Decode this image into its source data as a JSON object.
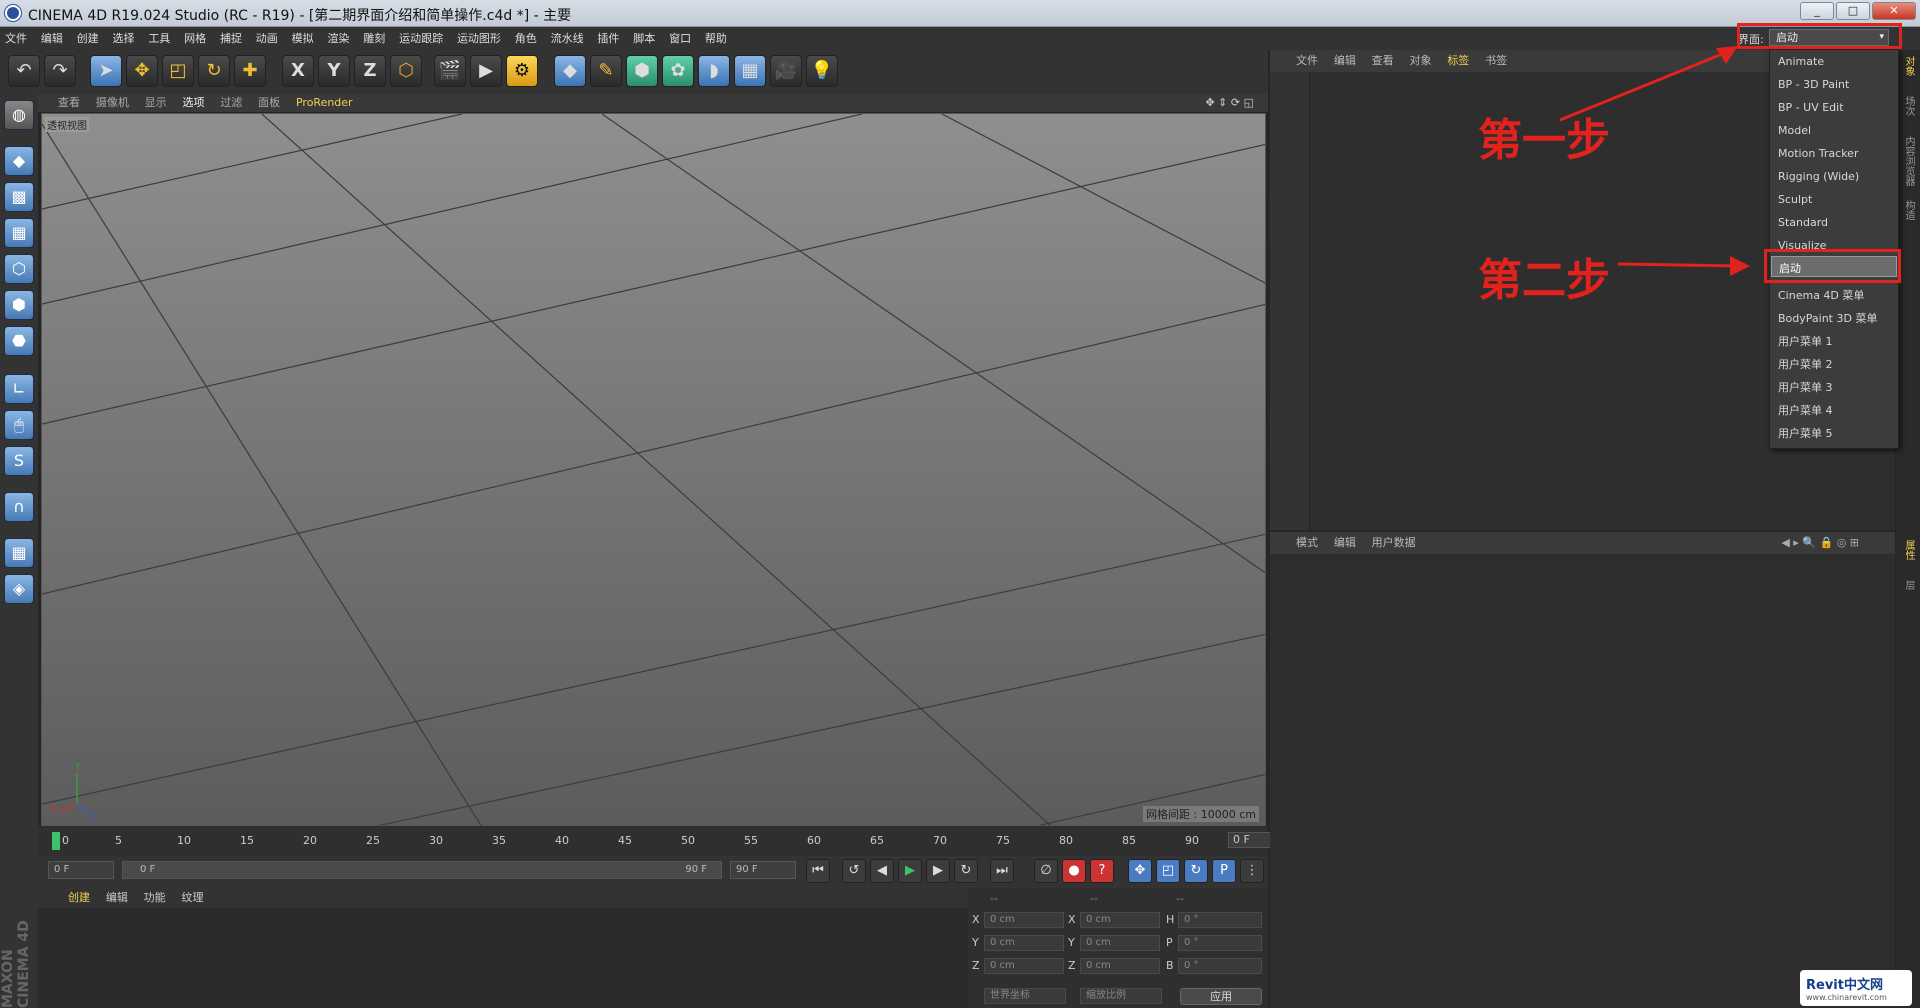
{
  "window": {
    "title": "CINEMA 4D R19.024 Studio (RC - R19) - [第二期界面介绍和简单操作.c4d *] - 主要",
    "controls": {
      "minimize": "_",
      "restore": "□",
      "close": "✕"
    }
  },
  "menu": [
    "文件",
    "编辑",
    "创建",
    "选择",
    "工具",
    "网格",
    "捕捉",
    "动画",
    "模拟",
    "渲染",
    "雕刻",
    "运动跟踪",
    "运动图形",
    "角色",
    "流水线",
    "插件",
    "脚本",
    "窗口",
    "帮助"
  ],
  "layout_selector": {
    "label": "界面:",
    "value": "启动",
    "arrow": "▾"
  },
  "toolbar_icons": [
    "undo-icon",
    "redo-icon",
    "select-icon",
    "move-icon",
    "scale-icon",
    "rotate-icon",
    "add-icon",
    "x-axis-icon",
    "y-axis-icon",
    "z-axis-icon",
    "coordinate-system-icon",
    "render-view-icon",
    "render-picture-queue-icon",
    "render-settings-icon",
    "cube-icon",
    "pen-icon",
    "subdivision-icon",
    "cloner-icon",
    "deformer-icon",
    "floor-icon",
    "camera-icon",
    "light-icon"
  ],
  "toolbar_glyphs": {
    "x": "X",
    "y": "Y",
    "z": "Z"
  },
  "viewport": {
    "menu": [
      "查看",
      "摄像机",
      "显示",
      "选项",
      "过滤",
      "面板",
      "ProRender"
    ],
    "label": "透视视图",
    "grid_info": "网格间距 : 10000 cm",
    "axis": {
      "x": "X",
      "y": "Y",
      "z": "Z"
    }
  },
  "timeline": {
    "ticks": [
      "0",
      "5",
      "10",
      "15",
      "20",
      "25",
      "30",
      "35",
      "40",
      "45",
      "50",
      "55",
      "60",
      "65",
      "70",
      "75",
      "80",
      "85",
      "90"
    ],
    "current_frame": "0 F"
  },
  "transport": {
    "start_field": "0 F",
    "range_start": "0 F",
    "range_end": "90 F",
    "end_field": "90 F"
  },
  "material_panel": {
    "tabs": [
      "创建",
      "编辑",
      "功能",
      "纹理"
    ]
  },
  "coord_panel": {
    "headers": [
      "--",
      "--",
      "--"
    ],
    "rows": [
      {
        "a": "X",
        "av": "0 cm",
        "b": "X",
        "bv": "0 cm",
        "c": "H",
        "cv": "0 °"
      },
      {
        "a": "Y",
        "av": "0 cm",
        "b": "Y",
        "bv": "0 cm",
        "c": "P",
        "cv": "0 °"
      },
      {
        "a": "Z",
        "av": "0 cm",
        "b": "Z",
        "bv": "0 cm",
        "c": "B",
        "cv": "0 °"
      }
    ],
    "mode_world": "世界坐标",
    "mode_scale": "缩放比例",
    "apply": "应用"
  },
  "object_manager": {
    "tabs": [
      "文件",
      "编辑",
      "查看",
      "对象",
      "标签",
      "书签"
    ],
    "active_tab": "标签"
  },
  "attribute_manager": {
    "tabs": [
      "模式",
      "编辑",
      "用户数据"
    ]
  },
  "right_strip": [
    "对象",
    "场次",
    "内容浏览器",
    "构造",
    "属性",
    "层"
  ],
  "layout_dropdown": {
    "items": [
      "Animate",
      "BP - 3D Paint",
      "BP - UV Edit",
      "Model",
      "Motion Tracker",
      "Rigging (Wide)",
      "Sculpt",
      "Standard",
      "Visualize"
    ],
    "selected": "启动",
    "items_after": [
      "Cinema 4D 菜单",
      "BodyPaint 3D 菜单",
      "用户菜单 1",
      "用户菜单 2",
      "用户菜单 3",
      "用户菜单 4",
      "用户菜单 5"
    ]
  },
  "annotations": {
    "step1": "第一步",
    "step2": "第二步",
    "color": "#e2221c"
  },
  "branding": {
    "maxon": "MAXON CINEMA 4D",
    "watermark": "Revit中文网",
    "watermark_url": "www.chinarevit.com"
  }
}
